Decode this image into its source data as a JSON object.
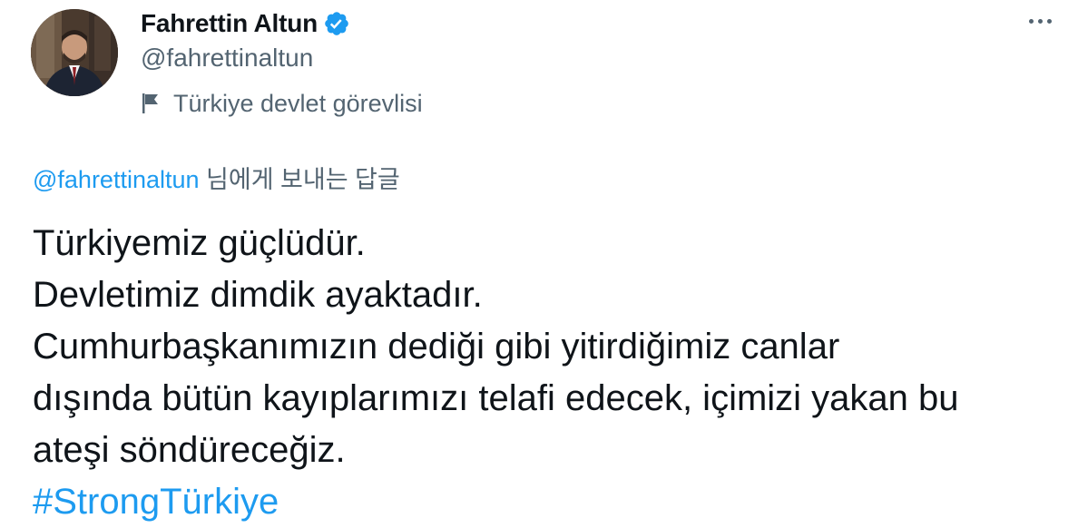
{
  "tweet": {
    "author": {
      "display_name": "Fahrettin Altun",
      "handle": "@fahrettinaltun",
      "verified": true,
      "label": "Türkiye devlet görevlisi",
      "avatar_icon": "profile-photo"
    },
    "more_icon": "more-options-icon",
    "reply_to": {
      "handle": "@fahrettinaltun",
      "suffix": " 님에게 보내는 답글"
    },
    "text_lines": [
      "Türkiyemiz güçlüdür.",
      "Devletimiz dimdik ayaktadır.",
      "Cumhurbaşkanımızın dediği gibi yitirdiğimiz canlar",
      "dışında bütün kayıplarımızı telafi edecek, içimizi yakan bu",
      "ateşi söndüreceğiz."
    ],
    "hashtag": "#StrongTürkiye"
  },
  "colors": {
    "accent": "#1d9bf0",
    "text_primary": "#0f1419",
    "text_secondary": "#536471",
    "background": "#ffffff"
  }
}
